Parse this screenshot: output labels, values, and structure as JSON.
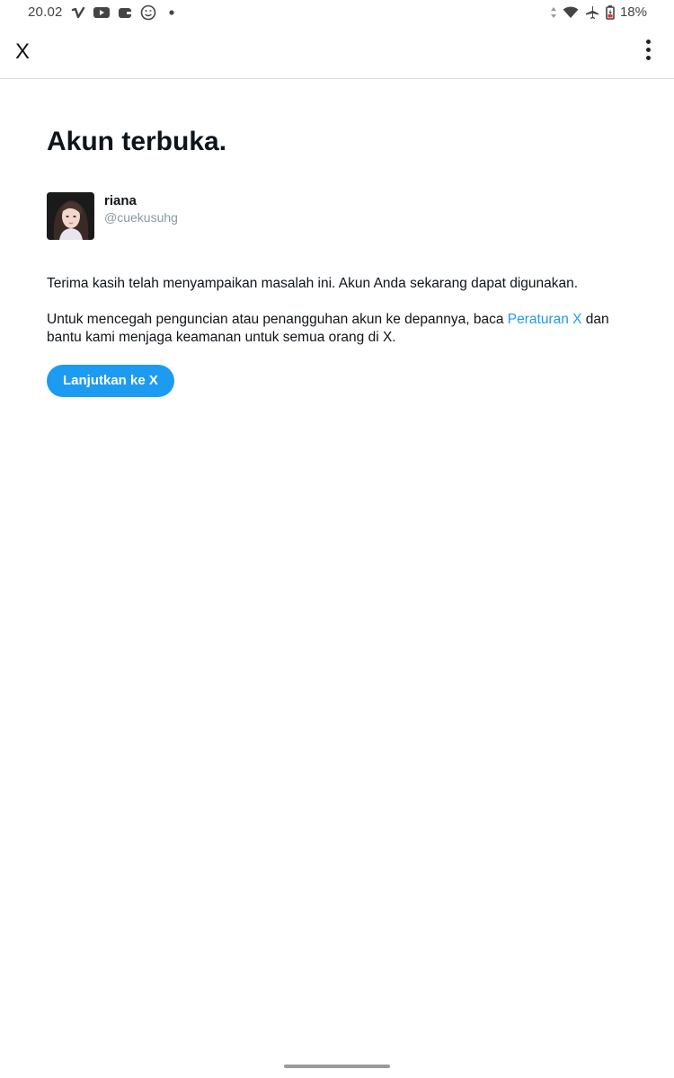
{
  "status_bar": {
    "time": "20.02",
    "battery": "18%",
    "left_icons": [
      "vimeo-icon",
      "youtube-icon",
      "wallet-icon",
      "emoji-icon",
      "dot-icon"
    ],
    "right_icons": [
      "data-arrows-icon",
      "wifi-icon",
      "airplane-icon",
      "battery-icon"
    ]
  },
  "app_bar": {
    "close_label": "X",
    "more_icon": "more-vertical-icon"
  },
  "main": {
    "title": "Akun terbuka.",
    "user": {
      "name": "riana",
      "handle": "@cuekusuhg"
    },
    "para1": "Terima kasih telah menyampaikan masalah ini. Akun Anda sekarang dapat digunakan.",
    "para2_before": "Untuk mencegah penguncian atau penangguhan akun ke depannya, baca ",
    "para2_link": "Peraturan X",
    "para2_after": " dan bantu kami menjaga keamanan untuk semua orang di X.",
    "button_label": "Lanjutkan ke X"
  },
  "colors": {
    "accent": "#1d9bf0",
    "text": "#0f1419",
    "muted": "#8a98a5"
  }
}
